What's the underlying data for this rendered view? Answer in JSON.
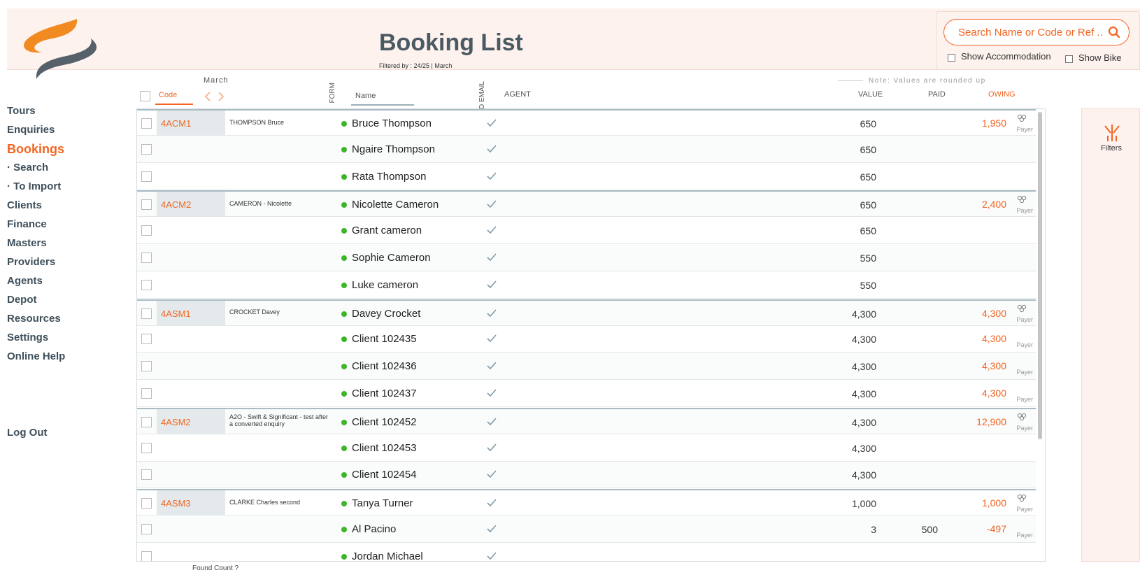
{
  "header": {
    "title": "Booking List",
    "filtered_by": "Filtered by : 24/25 | March"
  },
  "search": {
    "placeholder": "Search Name or Code or Ref ...",
    "show_accommodation": "Show Accommodation",
    "show_bike": "Show Bike"
  },
  "nav": {
    "items": [
      "Tours",
      "Enquiries",
      "Bookings",
      "· Search",
      "· To Import",
      "Clients",
      "Finance",
      "Masters",
      "Providers",
      "Agents",
      "Depot",
      "Resources",
      "Settings",
      "Online Help"
    ],
    "active": "Bookings",
    "logout": "Log Out"
  },
  "columns": {
    "month": "March",
    "code": "Code",
    "form": "FORM",
    "name_placeholder": "Name",
    "valid_email": "VALID EMAIL",
    "agent": "AGENT",
    "note": "Note: Values are rounded up",
    "value": "VALUE",
    "paid": "PAID",
    "owing": "OWING"
  },
  "rows": [
    {
      "code": "4ACM1",
      "ref": "THOMPSON Bruce",
      "name": "Bruce Thompson",
      "value": "650",
      "paid": "",
      "owing": "1,950",
      "payer": "Payer",
      "first": true
    },
    {
      "code": "",
      "ref": "",
      "name": "Ngaire Thompson",
      "value": "650",
      "paid": "",
      "owing": "",
      "payer": "",
      "first": false
    },
    {
      "code": "",
      "ref": "",
      "name": "Rata Thompson",
      "value": "650",
      "paid": "",
      "owing": "",
      "payer": "",
      "first": false
    },
    {
      "code": "4ACM2",
      "ref": "CAMERON - Nicolette",
      "name": "Nicolette Cameron",
      "value": "650",
      "paid": "",
      "owing": "2,400",
      "payer": "Payer",
      "first": true
    },
    {
      "code": "",
      "ref": "",
      "name": "Grant cameron",
      "value": "650",
      "paid": "",
      "owing": "",
      "payer": "",
      "first": false
    },
    {
      "code": "",
      "ref": "",
      "name": "Sophie Cameron",
      "value": "550",
      "paid": "",
      "owing": "",
      "payer": "",
      "first": false
    },
    {
      "code": "",
      "ref": "",
      "name": "Luke cameron",
      "value": "550",
      "paid": "",
      "owing": "",
      "payer": "",
      "first": false
    },
    {
      "code": "4ASM1",
      "ref": "CROCKET Davey",
      "name": "Davey Crocket",
      "value": "4,300",
      "paid": "",
      "owing": "4,300",
      "payer": "Payer",
      "first": true
    },
    {
      "code": "",
      "ref": "",
      "name": "Client 102435",
      "value": "4,300",
      "paid": "",
      "owing": "4,300",
      "payer": "Payer",
      "first": false
    },
    {
      "code": "",
      "ref": "",
      "name": "Client 102436",
      "value": "4,300",
      "paid": "",
      "owing": "4,300",
      "payer": "Payer",
      "first": false
    },
    {
      "code": "",
      "ref": "",
      "name": "Client 102437",
      "value": "4,300",
      "paid": "",
      "owing": "4,300",
      "payer": "Payer",
      "first": false
    },
    {
      "code": "4ASM2",
      "ref": "A2O - Swift & Significant - test after a converted enquiry",
      "name": "Client 102452",
      "value": "4,300",
      "paid": "",
      "owing": "12,900",
      "payer": "Payer",
      "first": true
    },
    {
      "code": "",
      "ref": "",
      "name": "Client 102453",
      "value": "4,300",
      "paid": "",
      "owing": "",
      "payer": "",
      "first": false
    },
    {
      "code": "",
      "ref": "",
      "name": "Client 102454",
      "value": "4,300",
      "paid": "",
      "owing": "",
      "payer": "",
      "first": false
    },
    {
      "code": "4ASM3",
      "ref": "CLARKE Charles second",
      "name": "Tanya Turner",
      "value": "1,000",
      "paid": "",
      "owing": "1,000",
      "payer": "Payer",
      "first": true
    },
    {
      "code": "",
      "ref": "",
      "name": "Al Pacino",
      "value": "3",
      "paid": "500",
      "owing": "-497",
      "payer": "Payer",
      "first": false
    },
    {
      "code": "",
      "ref": "",
      "name": "Jordan Michael",
      "value": "",
      "paid": "",
      "owing": "",
      "payer": "",
      "first": false
    }
  ],
  "filters_label": "Filters",
  "found_count": "Found Count ?",
  "colors": {
    "accent": "#f26522",
    "nav": "#3e4f5a",
    "status_dot": "#3cb529"
  }
}
